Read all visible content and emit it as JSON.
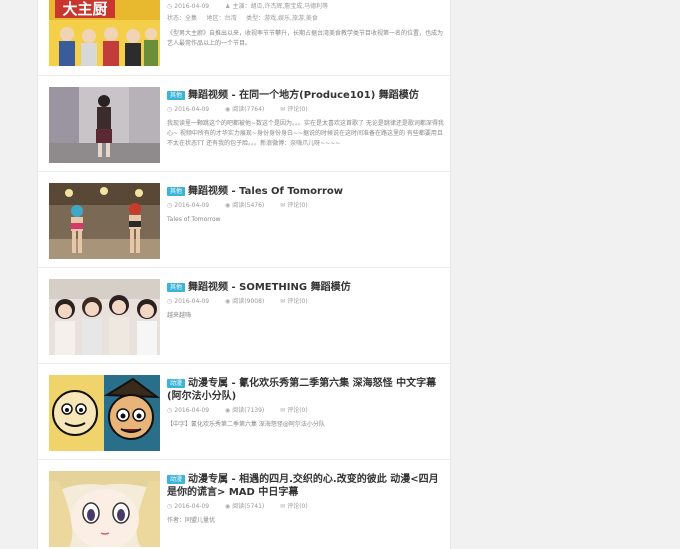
{
  "posts": [
    {
      "date": "2016-04-09",
      "actors_label": "主演：胡瓜,许杰辉,詹宝成,马德利等",
      "status_label": "状态：全集",
      "region_label": "地区：台湾",
      "genre_label": "类型：游戏,娱乐,旅游,美食",
      "excerpt": "《型男大主廚》自推出以来，收视率节节攀升，长期占据台湾美食教学类节目收视第一名的位置，也成为艺人最常作品以上的一个节目。",
      "thumb_text": "大主厨"
    },
    {
      "badge": "其他",
      "title": "舞蹈视频 - 在同一个地方(Produce101) 舞蹈模仿",
      "date": "2016-04-09",
      "views": "阅读(7764)",
      "comments": "评论(0)",
      "excerpt": "我现读里一颗跳这个的吧都被他~数这个是因为。。。实在是太喜欢这首歌了 无论是跳律还是歌词都深得我心~ 视频中所有的才华实力展现~身份身份身白~~据说的时候说在这时间准备在路这里的 有些都要用且不太在状态TT 还有我的包子脸。。。新浪微博：奈嗨爪儿呀~~~~"
    },
    {
      "badge": "其他",
      "title": "舞蹈视频 - Tales Of Tomorrow",
      "date": "2016-04-09",
      "views": "阅读(5476)",
      "comments": "评论(0)",
      "excerpt": "Tales of Tomorrow"
    },
    {
      "badge": "其他",
      "title": "舞蹈视频 - SOMETHING 舞蹈模仿",
      "date": "2016-04-09",
      "views": "阅读(9008)",
      "comments": "评论(0)",
      "excerpt": "越来越嗨"
    },
    {
      "badge": "动漫",
      "title": "动漫专属 - 氰化欢乐秀第二季第六集 深海怒怪 中文字幕(阿尔法小分队)",
      "date": "2016-04-09",
      "views": "阅读(7139)",
      "comments": "评论(0)",
      "excerpt": "【中字】氰化欢乐秀第二季第六集 深海怒怪@阿尔法小分队"
    },
    {
      "badge": "动漫",
      "title": "动漫专属 - 相遇的四月.交织的心.改变的彼此 动漫<四月是你的谎言> MAD 中日字幕",
      "date": "2016-04-09",
      "views": "阅读(5741)",
      "comments": "评论(0)",
      "excerpt": "作者：同盟儿量优"
    }
  ],
  "colors": {
    "badge": "#3cb3d8",
    "meta": "#999999",
    "title": "#333333"
  }
}
